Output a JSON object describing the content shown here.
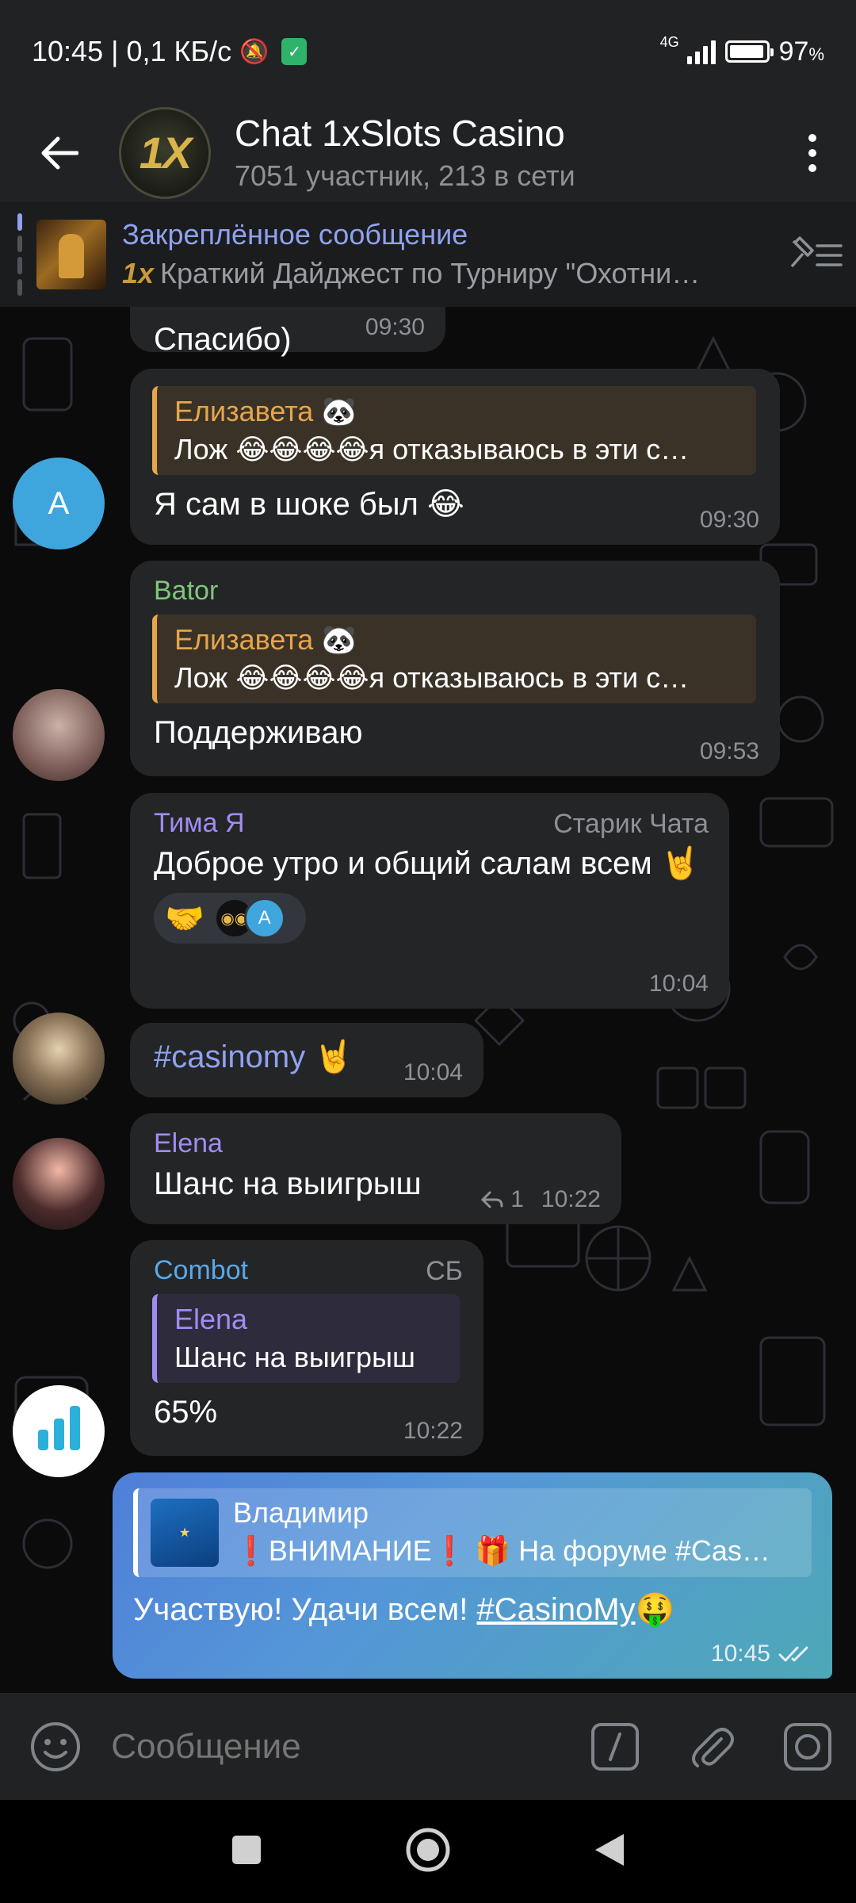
{
  "status_bar": {
    "time_speed": "10:45 | 0,1 КБ/с",
    "network": "4G",
    "battery_pct": "97",
    "battery_unit": "%",
    "battery_level": 0.97
  },
  "header": {
    "title": "Chat 1xSlots Casino",
    "subtitle": "7051 участник, 213 в сети",
    "avatar_text": "1X"
  },
  "pinned": {
    "title": "Закреплённое сообщение",
    "logo": "1x",
    "preview": "Краткий Дайджест по Турниру \"Охотни…"
  },
  "messages": [
    {
      "text": "Спасибо)",
      "time": "09:30"
    },
    {
      "avatar": "A",
      "reply_name": "Елизавета 🐼",
      "reply_text": "Лож 😂😂😂😂я отказываюсь в эти с…",
      "text": "Я сам в шоке был 😂",
      "time": "09:30"
    },
    {
      "sender": "Bator",
      "reply_name": "Елизавета 🐼",
      "reply_text": "Лож 😂😂😂😂я отказываюсь в эти с…",
      "text": "Поддерживаю",
      "time": "09:53"
    },
    {
      "sender": "Тима Я",
      "badge": "Старик Чата",
      "text": "Доброе утро и общий салам всем 🤘",
      "reaction_emoji": "🤝",
      "reaction_avatar_a": "A",
      "time": "10:04"
    },
    {
      "hashtag": "#casinomy",
      "text": " 🤘",
      "time": "10:04"
    },
    {
      "sender": "Elena",
      "text": "Шанс на выигрыш",
      "reply_count": "1",
      "time": "10:22"
    },
    {
      "sender": "Combot",
      "badge": "СБ",
      "reply_name": "Elena",
      "reply_text": "Шанс на выигрыш",
      "text": "65%",
      "time": "10:22"
    }
  ],
  "own_message": {
    "reply_name": "Владимир",
    "reply_text": "❗ВНИМАНИЕ❗ 🎁 На форуме #Cas…",
    "text_before": "Участвую! Удачи всем! ",
    "hashtag": "#CasinoMy",
    "text_after": "🤑",
    "time": "10:45"
  },
  "input": {
    "placeholder": "Сообщение"
  },
  "colors": {
    "accent": "#8fa2f0",
    "reply_orange": "#e7a54b",
    "bator_green": "#7ec77a",
    "violet": "#a28cf2",
    "combot_blue": "#5aa8e6"
  }
}
